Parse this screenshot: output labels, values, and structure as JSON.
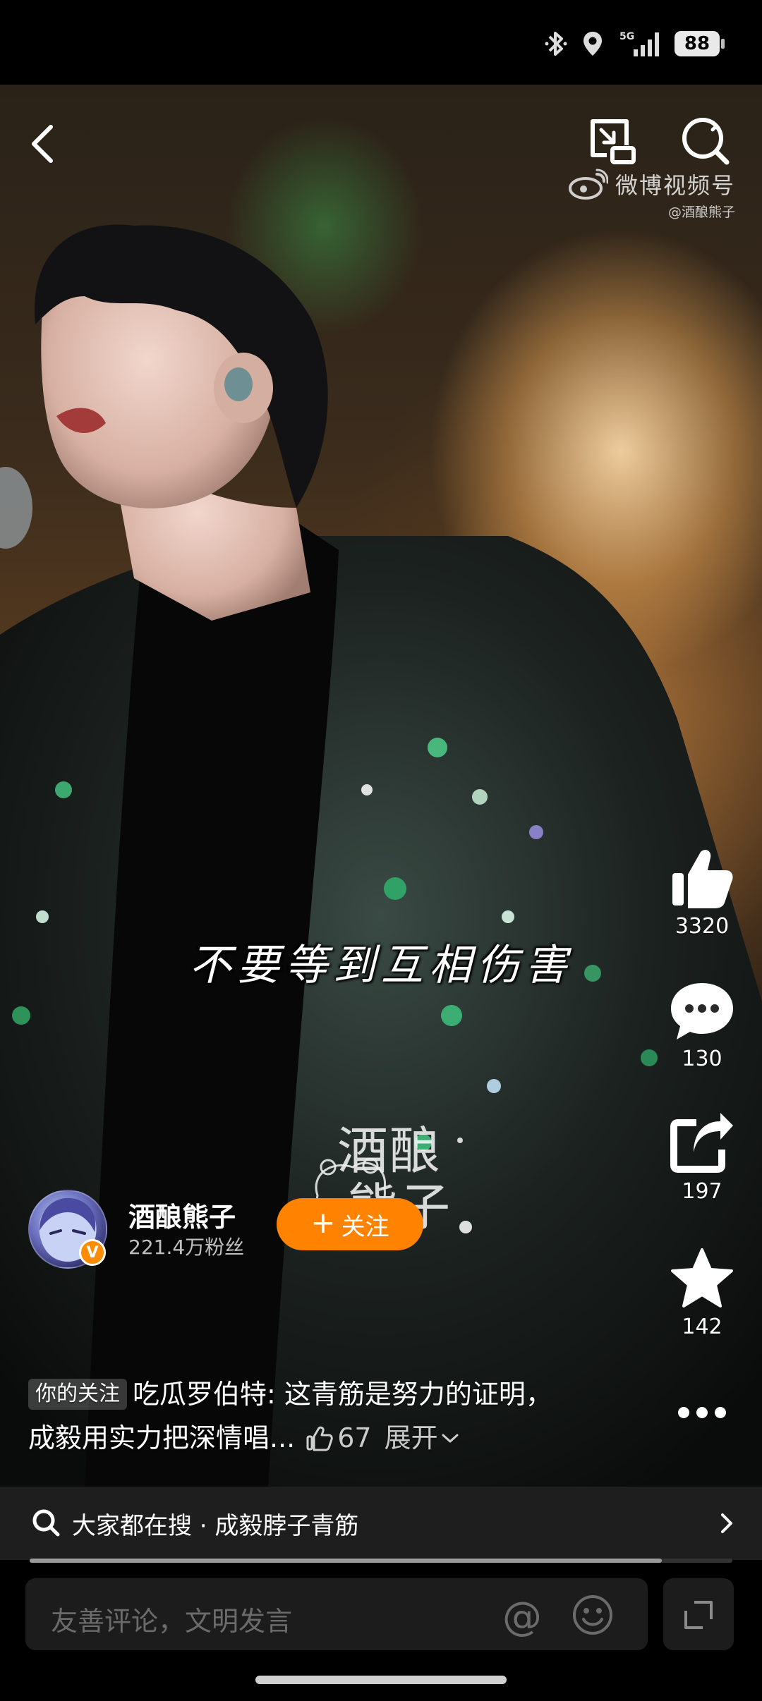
{
  "status_bar": {
    "network": "5G",
    "battery": "88"
  },
  "top_bar": {
    "back": "back",
    "pip": "picture-in-picture",
    "search": "search"
  },
  "watermark": {
    "brand": "微博视频号",
    "handle": "@酒酿熊子"
  },
  "video": {
    "subtitle": "不要等到互相伤害",
    "logo_line1": "酒酿",
    "logo_line2": "熊子"
  },
  "actions": {
    "like_count": "3320",
    "comment_count": "130",
    "share_count": "197",
    "favorite_count": "142"
  },
  "author": {
    "name": "酒酿熊子",
    "fans": "221.4万粉丝",
    "follow_label": "关注",
    "verified": "V"
  },
  "caption": {
    "tag": "你的关注",
    "text": "吃瓜罗伯特: 这青筋是努力的证明，成毅用实力把深情唱...",
    "likes": "67",
    "expand_label": "展开"
  },
  "trending": {
    "text": "大家都在搜 · 成毅脖子青筋"
  },
  "progress": {
    "fraction": 0.9
  },
  "comment_bar": {
    "placeholder": "友善评论，文明发言",
    "at_symbol": "@"
  },
  "colors": {
    "accent": "#ff8200",
    "background": "#000000"
  }
}
